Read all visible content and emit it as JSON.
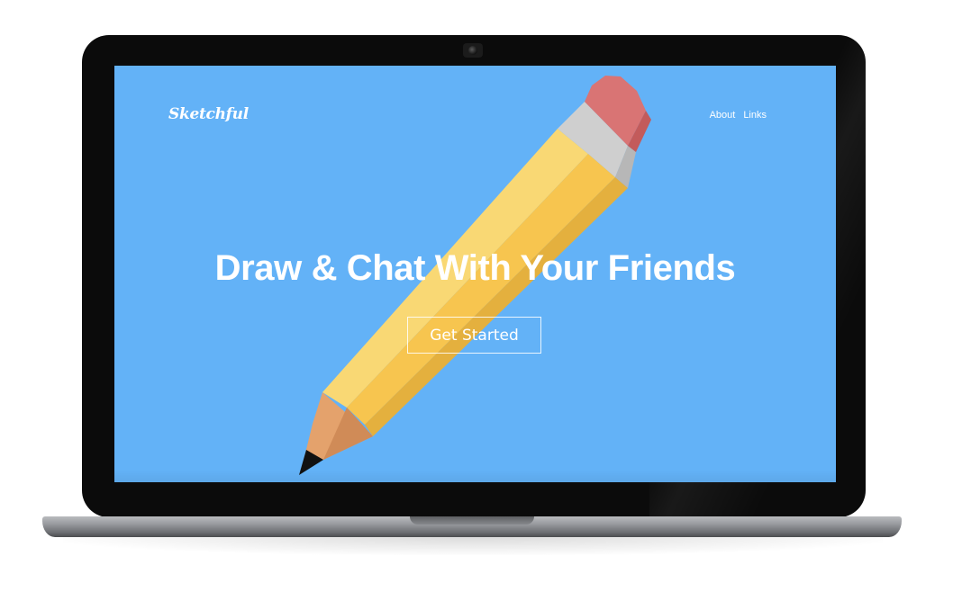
{
  "site": {
    "logo": "Sketchful"
  },
  "nav": {
    "items": [
      {
        "label": "About"
      },
      {
        "label": "Links"
      }
    ]
  },
  "hero": {
    "headline": "Draw & Chat With Your Friends",
    "cta_label": "Get Started"
  },
  "colors": {
    "screen_background": "#63b2f7",
    "pencil_body": "#f7c54f",
    "pencil_body_light": "#f9d874",
    "pencil_body_dark": "#e4b03e",
    "pencil_wood": "#e4a26c",
    "pencil_lead": "#111111",
    "ferrule": "#cfcfcf",
    "eraser": "#d97474",
    "laptop_bezel": "#0b0b0b",
    "laptop_base": "#9a9ca0"
  },
  "icons": {
    "pencil": "pencil-illustration",
    "camera": "webcam-icon"
  }
}
